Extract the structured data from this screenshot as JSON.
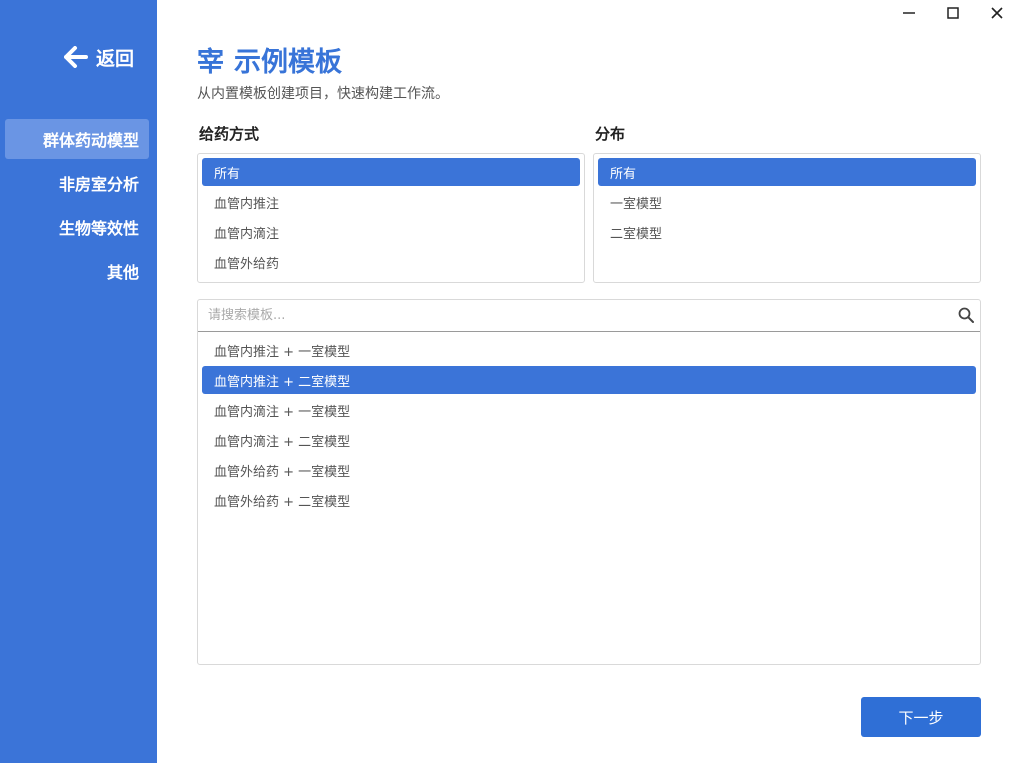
{
  "sidebar": {
    "back_label": "返回",
    "items": [
      {
        "label": "群体药动模型",
        "active": true
      },
      {
        "label": "非房室分析",
        "active": false
      },
      {
        "label": "生物等效性",
        "active": false
      },
      {
        "label": "其他",
        "active": false
      }
    ]
  },
  "header": {
    "icon_glyph": "宰",
    "title": "示例模板",
    "subtitle": "从内置模板创建项目，快速构建工作流。"
  },
  "administration": {
    "label": "给药方式",
    "options": [
      "所有",
      "血管内推注",
      "血管内滴注",
      "血管外给药"
    ],
    "selected": "所有"
  },
  "distribution": {
    "label": "分布",
    "options": [
      "所有",
      "一室模型",
      "二室模型"
    ],
    "selected": "所有"
  },
  "templates": {
    "search_placeholder": "请搜索模板...",
    "items": [
      "血管内推注 + 一室模型",
      "血管内推注 + 二室模型",
      "血管内滴注 + 一室模型",
      "血管内滴注 + 二室模型",
      "血管外给药 + 一室模型",
      "血管外给药 + 二室模型"
    ],
    "selected": "血管内推注 + 二室模型"
  },
  "footer": {
    "next_label": "下一步"
  },
  "colors": {
    "accent": "#3b74d8",
    "sidebar": "#3b74d8",
    "sidebar_active": "#6a95e4"
  }
}
